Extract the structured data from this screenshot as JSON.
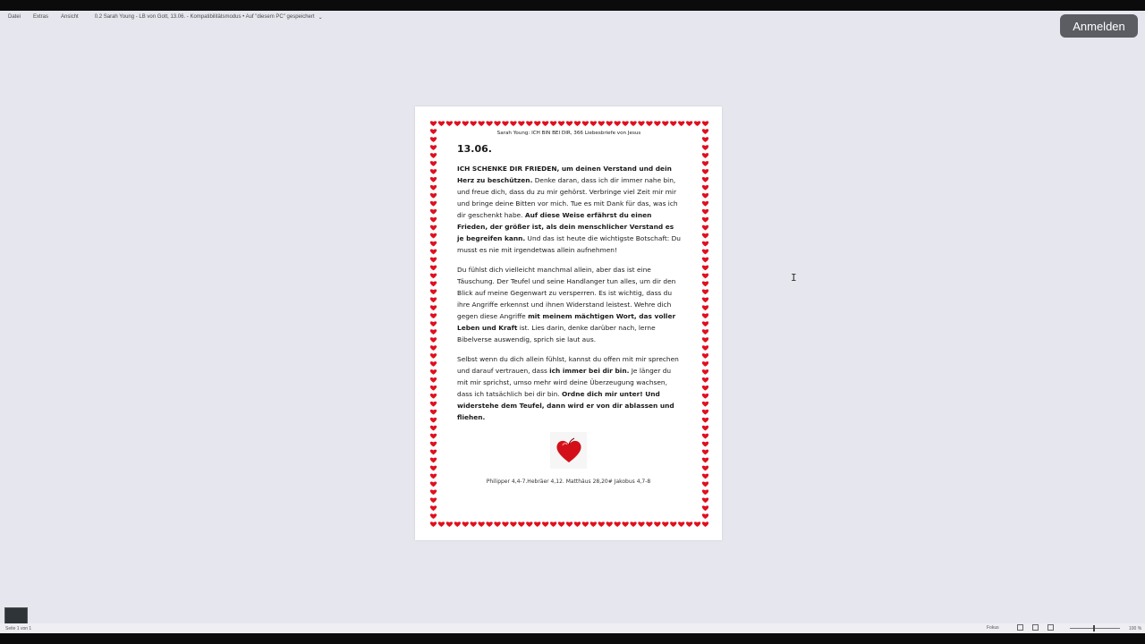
{
  "menu": {
    "items": [
      "Datei",
      "Extras",
      "Ansicht"
    ],
    "doc_title": "0.2  Sarah Young - LB von Gott, 13.06.  -  Kompatibilitätsmodus  •  Auf \"diesem PC\" gespeichert",
    "chevron": "⌄"
  },
  "signin_label": "Anmelden",
  "document": {
    "header": "Sarah Young: ICH BIN BEI DIR, 366 Liebesbriefe von Jesus",
    "date": "13.06.",
    "paragraphs": [
      [
        {
          "t": "ICH SCHENKE DIR FRIEDEN, um deinen Verstand und dein Herz zu beschützen.",
          "b": true
        },
        {
          "t": " Denke daran, dass ich dir immer nahe bin, und freue dich, dass du zu mir gehörst. Verbringe viel Zeit mir mir und bringe deine Bitten vor mich. Tue es mit Dank für das, was ich dir geschenkt habe. ",
          "b": false
        },
        {
          "t": "Auf diese Weise erfährst du einen Frieden, der größer ist, als dein menschlicher Verstand es je begreifen kann.",
          "b": true
        },
        {
          "t": " Und das ist heute die wichtigste Botschaft: Du musst es nie mit irgendetwas allein aufnehmen!",
          "b": false
        }
      ],
      [
        {
          "t": "Du fühlst dich vielleicht manchmal allein, aber das ist eine Täuschung. Der Teufel und seine Handlanger tun alles, um dir den Blick auf meine Gegenwart zu versperren. Es ist wichtig, dass du ihre Angriffe erkennst und ihnen Widerstand leistest. Wehre dich gegen diese Angriffe ",
          "b": false
        },
        {
          "t": "mit meinem mächtigen Wort, das voller Leben und Kraft",
          "b": true
        },
        {
          "t": " ist. Lies darin, denke darüber nach, lerne Bibelverse auswendig, sprich sie laut aus.",
          "b": false
        }
      ],
      [
        {
          "t": "Selbst wenn du dich allein fühlst, kannst du offen mit mir sprechen und darauf vertrauen, dass ",
          "b": false
        },
        {
          "t": "ich immer bei dir bin.",
          "b": true
        },
        {
          "t": " Je länger du mit mir sprichst, umso mehr wird deine Überzeugung wachsen, dass ich tatsächlich bei dir bin. ",
          "b": false
        },
        {
          "t": "Ordne dich mir unter! Und widerstehe dem Teufel, dann wird er von dir ablassen und fliehen.",
          "b": true
        }
      ]
    ],
    "references": "Philipper 4,4-7.Hebräer 4,12. Matthäus 28,20# Jakobus 4,7-8",
    "heart_icon": "red-heart-ornament",
    "border_color": "#e0101e"
  },
  "status": {
    "left_text": "Seite 1 von 1",
    "focus_label": "Fokus",
    "zoom": "100 %"
  }
}
